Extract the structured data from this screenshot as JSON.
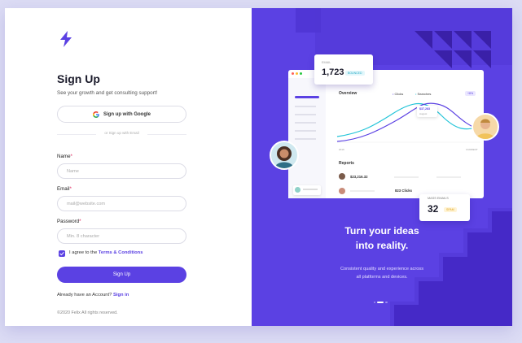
{
  "brand": {
    "accent": "#5b41e3",
    "logo_icon": "bolt-icon"
  },
  "signup": {
    "title": "Sign Up",
    "subtitle": "See your growth and get consulting support!",
    "google_label": "Sign up with Google",
    "divider_text": "or Sign up with Email",
    "name_label": "Name",
    "name_placeholder": "Name",
    "email_label": "Email",
    "email_placeholder": "mail@website.com",
    "password_label": "Password",
    "password_placeholder": "Min. 8 character",
    "required_mark": "*",
    "agree_prefix": "I agree to the ",
    "terms_link": "Terms & Conditions",
    "agree_checked": true,
    "submit_label": "Sign Up",
    "have_account": "Already have an Account?",
    "signin_link": "Sign in",
    "copyright": "©2020 Felix All rights reserved."
  },
  "promo": {
    "email_card": {
      "label": "EMAIL",
      "value": "1,723",
      "badge": "BOUNCED"
    },
    "dashboard": {
      "chart_title": "Overview",
      "legend_clicks": "Clicks",
      "legend_searches": "Searches",
      "percent_badge": "+8%",
      "tooltip_value": "$37,283",
      "tooltip_label": "August",
      "axis_start": "2019",
      "axis_end": "CURRENT",
      "reports_title": "Reports",
      "report_amount": "$23,216.32",
      "report_clicks": "823 Clicks"
    },
    "mass_card": {
      "label": "MASS EMAILS",
      "value": "32",
      "badge": "SPAM"
    },
    "headline_line1": "Turn your ideas",
    "headline_line2": "into reality.",
    "sub_line1": "Consistent quality and experience across",
    "sub_line2": "all platforms and devices."
  }
}
